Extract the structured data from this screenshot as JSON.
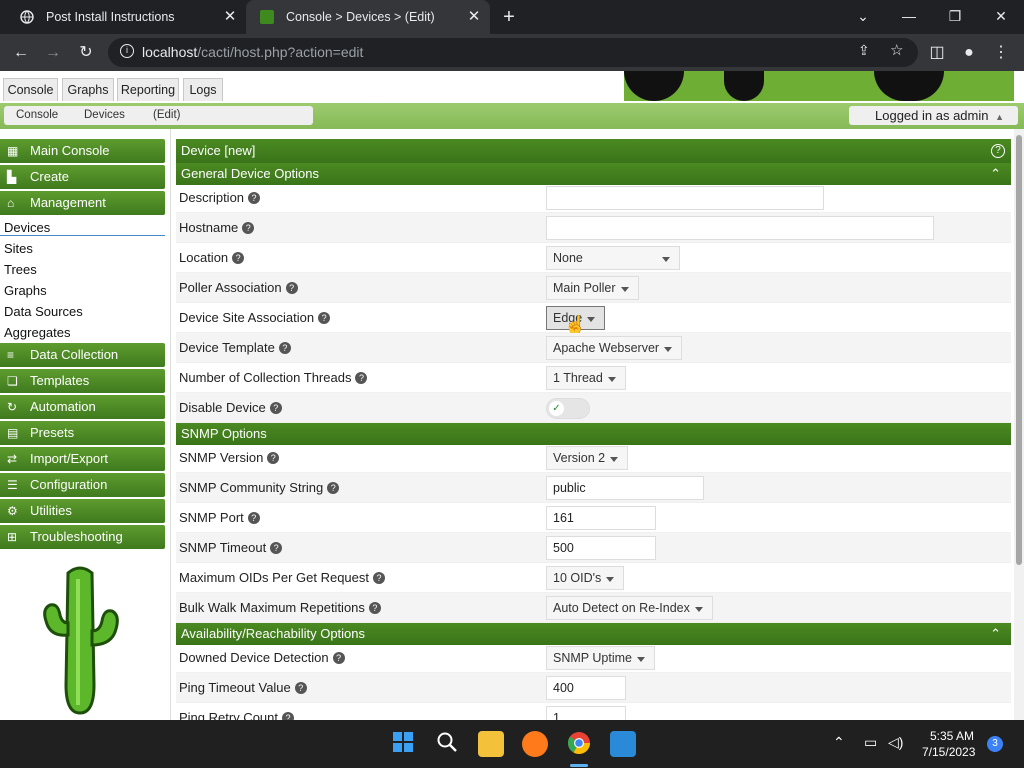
{
  "browser": {
    "tabs": [
      {
        "title": "Post Install Instructions"
      },
      {
        "title": "Console > Devices > (Edit)"
      }
    ],
    "url_host": "localhost",
    "url_path": "/cacti/host.php?action=edit"
  },
  "cacti": {
    "top_tabs": [
      "Console",
      "Graphs",
      "Reporting",
      "Logs"
    ],
    "breadcrumbs": [
      "Console",
      "Devices",
      "(Edit)"
    ],
    "logged_in": "Logged in as admin"
  },
  "sidebar": {
    "sections": [
      {
        "label": "Main Console",
        "icon": "map-icon"
      },
      {
        "label": "Create",
        "icon": "chart-icon"
      },
      {
        "label": "Management",
        "icon": "home-icon"
      },
      {
        "label": "Data Collection",
        "icon": "database-icon"
      },
      {
        "label": "Templates",
        "icon": "clone-icon"
      },
      {
        "label": "Automation",
        "icon": "automation-icon"
      },
      {
        "label": "Presets",
        "icon": "presets-icon"
      },
      {
        "label": "Import/Export",
        "icon": "exchange-icon"
      },
      {
        "label": "Configuration",
        "icon": "sliders-icon"
      },
      {
        "label": "Utilities",
        "icon": "cogs-icon"
      },
      {
        "label": "Troubleshooting",
        "icon": "sitemap-icon"
      }
    ],
    "management_items": [
      "Devices",
      "Sites",
      "Trees",
      "Graphs",
      "Data Sources",
      "Aggregates"
    ]
  },
  "form": {
    "title": "Device [new]",
    "sections": {
      "general": "General Device Options",
      "snmp": "SNMP Options",
      "availability": "Availability/Reachability Options"
    },
    "rows": [
      {
        "label": "Description",
        "value": "",
        "kind": "text"
      },
      {
        "label": "Hostname",
        "value": "",
        "kind": "text"
      },
      {
        "label": "Location",
        "value": "None",
        "kind": "select"
      },
      {
        "label": "Poller Association",
        "value": "Main Poller",
        "kind": "select"
      },
      {
        "label": "Device Site Association",
        "value": "Edge",
        "kind": "select"
      },
      {
        "label": "Device Template",
        "value": "Apache Webserver",
        "kind": "select"
      },
      {
        "label": "Number of Collection Threads",
        "value": "1 Thread",
        "kind": "select"
      },
      {
        "label": "Disable Device",
        "value": "",
        "kind": "toggle"
      },
      {
        "label": "SNMP Version",
        "value": "Version 2",
        "kind": "select"
      },
      {
        "label": "SNMP Community String",
        "value": "public",
        "kind": "text"
      },
      {
        "label": "SNMP Port",
        "value": "161",
        "kind": "text"
      },
      {
        "label": "SNMP Timeout",
        "value": "500",
        "kind": "text"
      },
      {
        "label": "Maximum OIDs Per Get Request",
        "value": "10 OID's",
        "kind": "select"
      },
      {
        "label": "Bulk Walk Maximum Repetitions",
        "value": "Auto Detect on Re-Index",
        "kind": "select"
      },
      {
        "label": "Downed Device Detection",
        "value": "SNMP Uptime",
        "kind": "select"
      },
      {
        "label": "Ping Timeout Value",
        "value": "400",
        "kind": "text"
      },
      {
        "label": "Ping Retry Count",
        "value": "1",
        "kind": "text"
      }
    ]
  },
  "taskbar": {
    "time": "5:35 AM",
    "date": "7/15/2023",
    "notifications": "3"
  }
}
